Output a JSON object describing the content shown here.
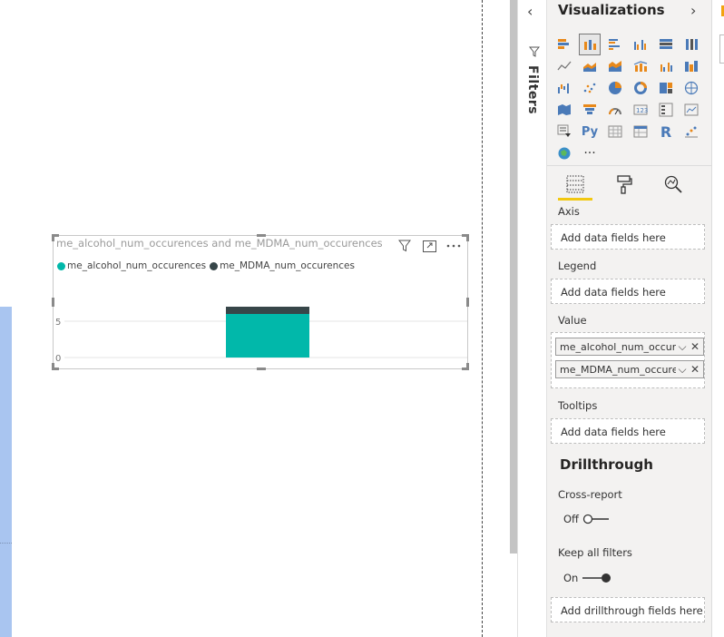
{
  "visual": {
    "title": "me_alcohol_num_occurences and me_MDMA_num_occurences",
    "legend": [
      {
        "label": "me_alcohol_num_occurences",
        "color": "#01b8aa"
      },
      {
        "label": "me_MDMA_num_occurences",
        "color": "#374649"
      }
    ],
    "icons": [
      "filter-icon",
      "focus-mode-icon",
      "more-options-icon"
    ]
  },
  "chart_data": {
    "type": "bar",
    "stacked": true,
    "categories": [
      ""
    ],
    "series": [
      {
        "name": "me_alcohol_num_occurences",
        "values": [
          6
        ],
        "color": "#01b8aa"
      },
      {
        "name": "me_MDMA_num_occurences",
        "values": [
          1
        ],
        "color": "#374649"
      }
    ],
    "yticks": [
      "0",
      "5"
    ],
    "ylim": [
      0,
      10
    ]
  },
  "filters": {
    "label": "Filters"
  },
  "viz_pane": {
    "title": "Visualizations",
    "more_label": "···",
    "sections": {
      "axis": {
        "label": "Axis",
        "placeholder": "Add data fields here"
      },
      "legend": {
        "label": "Legend",
        "placeholder": "Add data fields here"
      },
      "value": {
        "label": "Value",
        "fields": [
          "me_alcohol_num_occurences",
          "me_MDMA_num_occurences"
        ]
      },
      "tooltips": {
        "label": "Tooltips",
        "placeholder": "Add data fields here"
      }
    },
    "drillthrough": {
      "title": "Drillthrough",
      "cross_report": {
        "label": "Cross-report",
        "state": "Off"
      },
      "keep_filters": {
        "label": "Keep all filters",
        "state": "On"
      },
      "add_label": "Add drillthrough fields here"
    }
  }
}
